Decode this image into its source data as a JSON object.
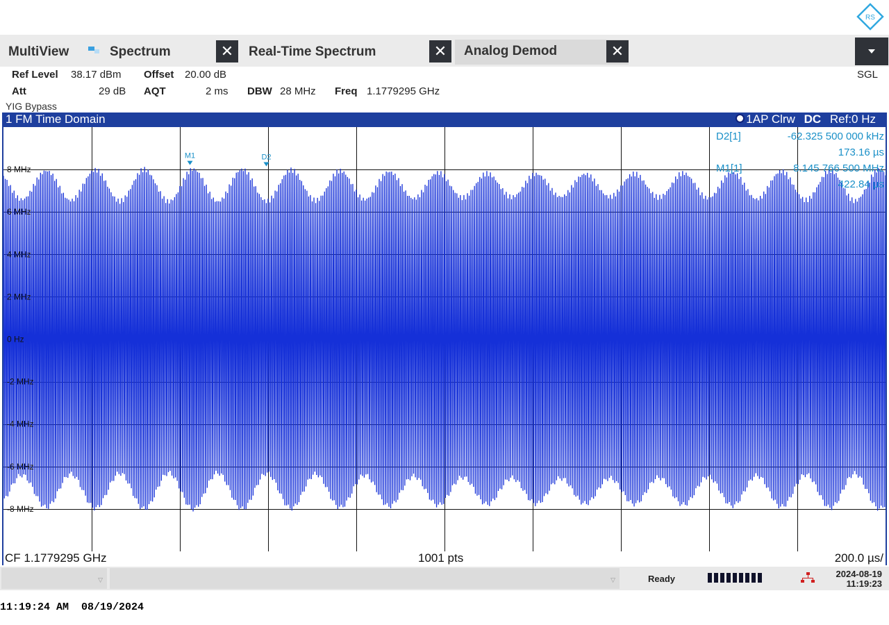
{
  "header": {
    "tabs": [
      {
        "label": "MultiView"
      },
      {
        "label": "Spectrum",
        "close": "✕"
      },
      {
        "label": "Real-Time Spectrum",
        "close": "✕"
      },
      {
        "label": "Analog Demod",
        "close": "✕",
        "active": true
      }
    ],
    "menu_icon": "dropdown-arrow-icon",
    "logo_text": "RS"
  },
  "params": {
    "ref_level_label": "Ref Level",
    "ref_level_value": "38.17 dBm",
    "offset_label": "Offset",
    "offset_value": "20.00 dB",
    "att_label": "Att",
    "att_value": "29 dB",
    "aqt_label": "AQT",
    "aqt_value": "2 ms",
    "dbw_label": "DBW",
    "dbw_value": "28 MHz",
    "freq_label": "Freq",
    "freq_value": "1.1779295 GHz",
    "sgl": "SGL",
    "yig": "YIG Bypass"
  },
  "panel": {
    "title": "1 FM Time Domain",
    "trace_info": "1AP Clrw",
    "coupling": "DC",
    "ref": "Ref:0 Hz"
  },
  "markers": {
    "d2_label": "D2[1]",
    "d2_value": "-62.325 500 000 kHz",
    "d2_time": "173.16 µs",
    "m1_label": "M1[1]",
    "m1_value": "8.145 766 500 MHz",
    "m1_time": "422.84 µs",
    "m1_tag": "M1",
    "d2_tag": "D2"
  },
  "footer": {
    "cf": "CF 1.1779295 GHz",
    "pts": "1001 pts",
    "span": "200.0 µs/"
  },
  "status": {
    "ready": "Ready",
    "date": "2024-08-19",
    "time": "11:19:23"
  },
  "timestamp": "11:19:24 AM  08/19/2024",
  "colors": {
    "trace": "#1530d8",
    "panel_header": "#1e3f9e",
    "marker_text": "#1a90c8"
  },
  "chart_data": {
    "type": "line",
    "title": "1 FM Time Domain",
    "xlabel": "",
    "ylabel": "",
    "y_unit": "MHz",
    "y_ticks": [
      {
        "value": 8,
        "label": "8 MHz"
      },
      {
        "value": 6,
        "label": "6 MHz"
      },
      {
        "value": 4,
        "label": "4 MHz"
      },
      {
        "value": 2,
        "label": "2 MHz"
      },
      {
        "value": 0,
        "label": "0 Hz"
      },
      {
        "value": -2,
        "label": "-2 MHz"
      },
      {
        "value": -4,
        "label": "-4 MHz"
      },
      {
        "value": -6,
        "label": "-6 MHz"
      },
      {
        "value": -8,
        "label": "-8 MHz"
      }
    ],
    "ylim": [
      -10,
      10
    ],
    "xlim_us": [
      0,
      2000
    ],
    "x_div_us": 200,
    "points": 1001,
    "grid": true,
    "signal": {
      "peak_max_mhz": 8.1,
      "peak_min_mhz": -8.1,
      "swing_upper_low_mhz": 6.4,
      "swing_lower_high_mhz": -6.2,
      "oscillations_in_sweep": 260,
      "envelope_lobes": 18
    },
    "markers": [
      {
        "name": "M1",
        "x_us": 422.84,
        "y_mhz": 8.1458
      },
      {
        "name": "D2",
        "x_us": 595.99,
        "y_mhz": 8.0834
      }
    ]
  }
}
